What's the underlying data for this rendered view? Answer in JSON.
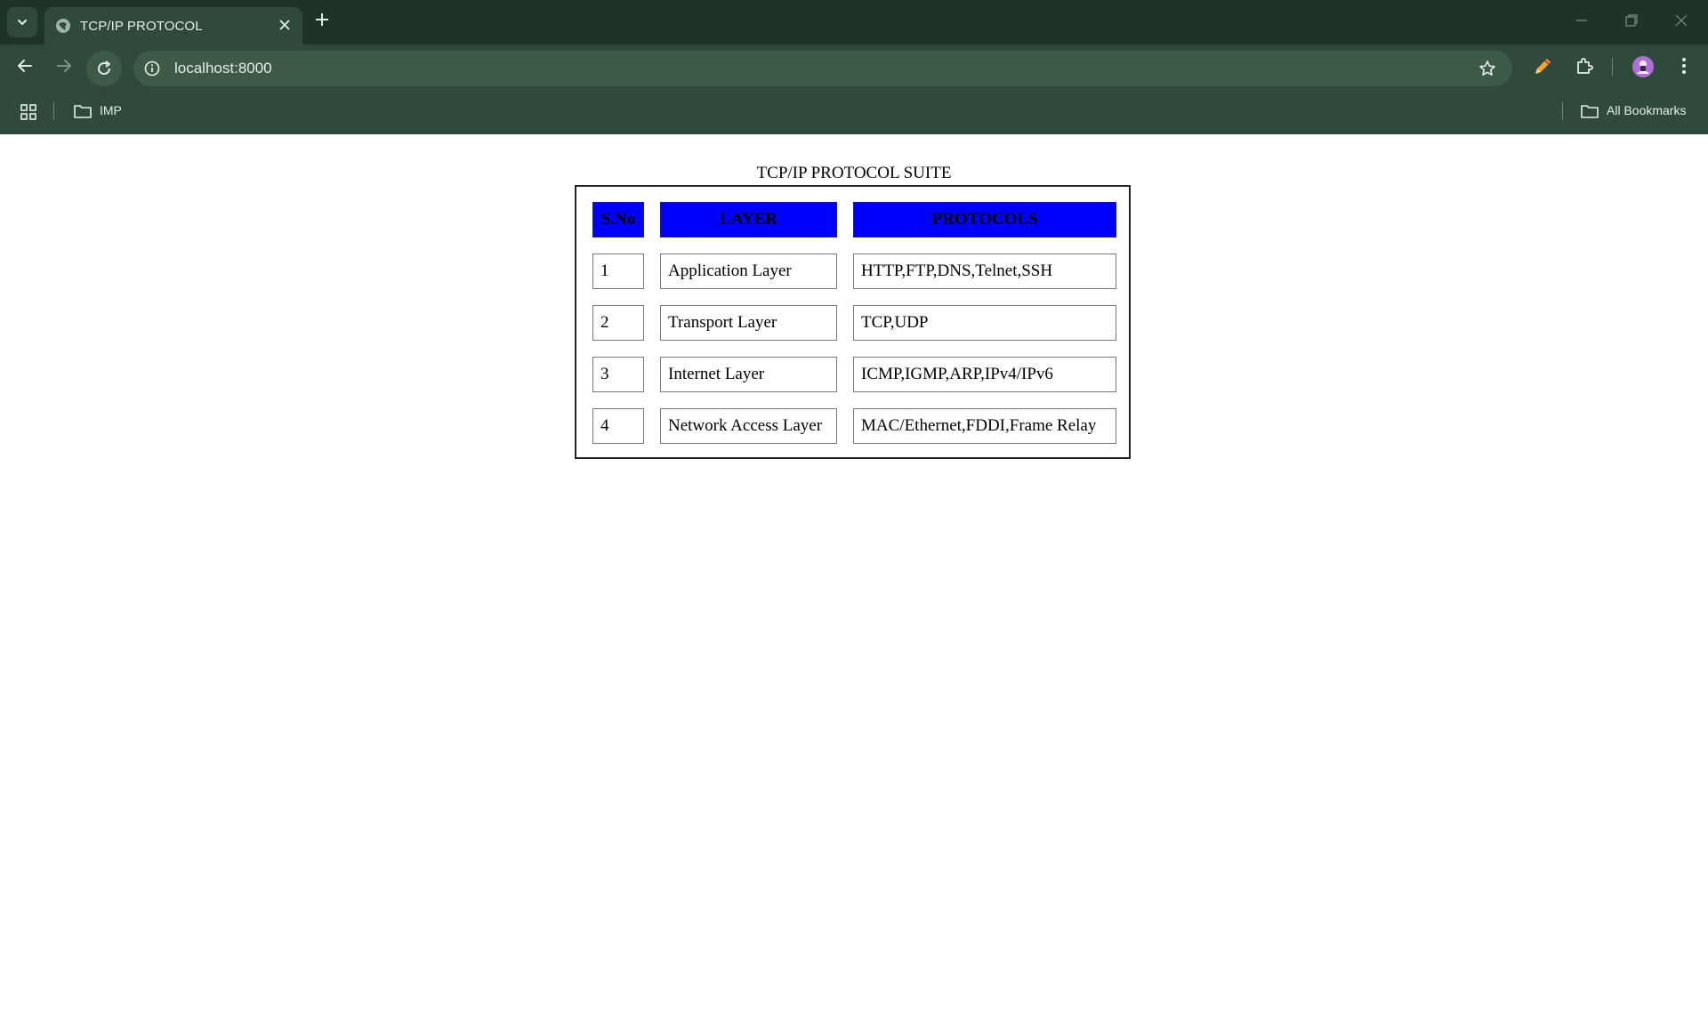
{
  "browser": {
    "tab_title": "TCP/IP PROTOCOL",
    "url": "localhost:8000",
    "bookmarks": {
      "folder": "IMP",
      "all_bookmarks": "All Bookmarks"
    },
    "icons": [
      "tab-search-icon",
      "globe-icon",
      "close-icon",
      "plus-icon",
      "minimize-icon",
      "restore-icon",
      "window-close-icon",
      "back-arrow-icon",
      "forward-arrow-icon",
      "reload-icon",
      "info-icon",
      "star-icon",
      "pencil-icon",
      "puzzle-icon",
      "profile-icon",
      "kebab-menu-icon",
      "apps-grid-icon",
      "folder-icon"
    ]
  },
  "page": {
    "caption": "TCP/IP PROTOCOL SUITE",
    "headers": {
      "sno": "S.No",
      "layer": "LAYER",
      "protocols": "PROTOCOLS"
    },
    "rows": [
      {
        "sno": "1",
        "layer": "Application Layer",
        "protocols": "HTTP,FTP,DNS,Telnet,SSH"
      },
      {
        "sno": "2",
        "layer": "Transport Layer",
        "protocols": "TCP,UDP"
      },
      {
        "sno": "3",
        "layer": "Internet Layer",
        "protocols": "ICMP,IGMP,ARP,IPv4/IPv6"
      },
      {
        "sno": "4",
        "layer": "Network Access Layer",
        "protocols": "MAC/Ethernet,FDDI,Frame Relay"
      }
    ]
  },
  "colors": {
    "chrome_dark": "#1f3327",
    "chrome_mid": "#2f4a3a",
    "header_cell": "#0000ff"
  }
}
